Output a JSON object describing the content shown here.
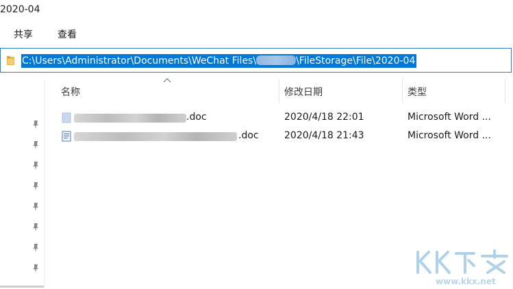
{
  "window": {
    "title": "2020-04"
  },
  "ribbon": {
    "tabs": [
      {
        "label": "共享"
      },
      {
        "label": "查看"
      }
    ]
  },
  "address_bar": {
    "path_prefix": "C:\\Users\\Administrator\\Documents\\WeChat Files\\",
    "path_suffix": "\\FileStorage\\File\\2020-04"
  },
  "columns": {
    "name": "名称",
    "date": "修改日期",
    "type": "类型"
  },
  "files": [
    {
      "name_suffix": ".doc",
      "modified": "2020/4/18 22:01",
      "type": "Microsoft Word ..."
    },
    {
      "name_suffix": ".doc",
      "modified": "2020/4/18 21:43",
      "type": "Microsoft Word ..."
    }
  ],
  "watermark": {
    "url": "www.kkx.net"
  },
  "colors": {
    "selection": "#0078d7",
    "address_border": "#2a7bd4",
    "watermark": "#9cc7e6"
  }
}
